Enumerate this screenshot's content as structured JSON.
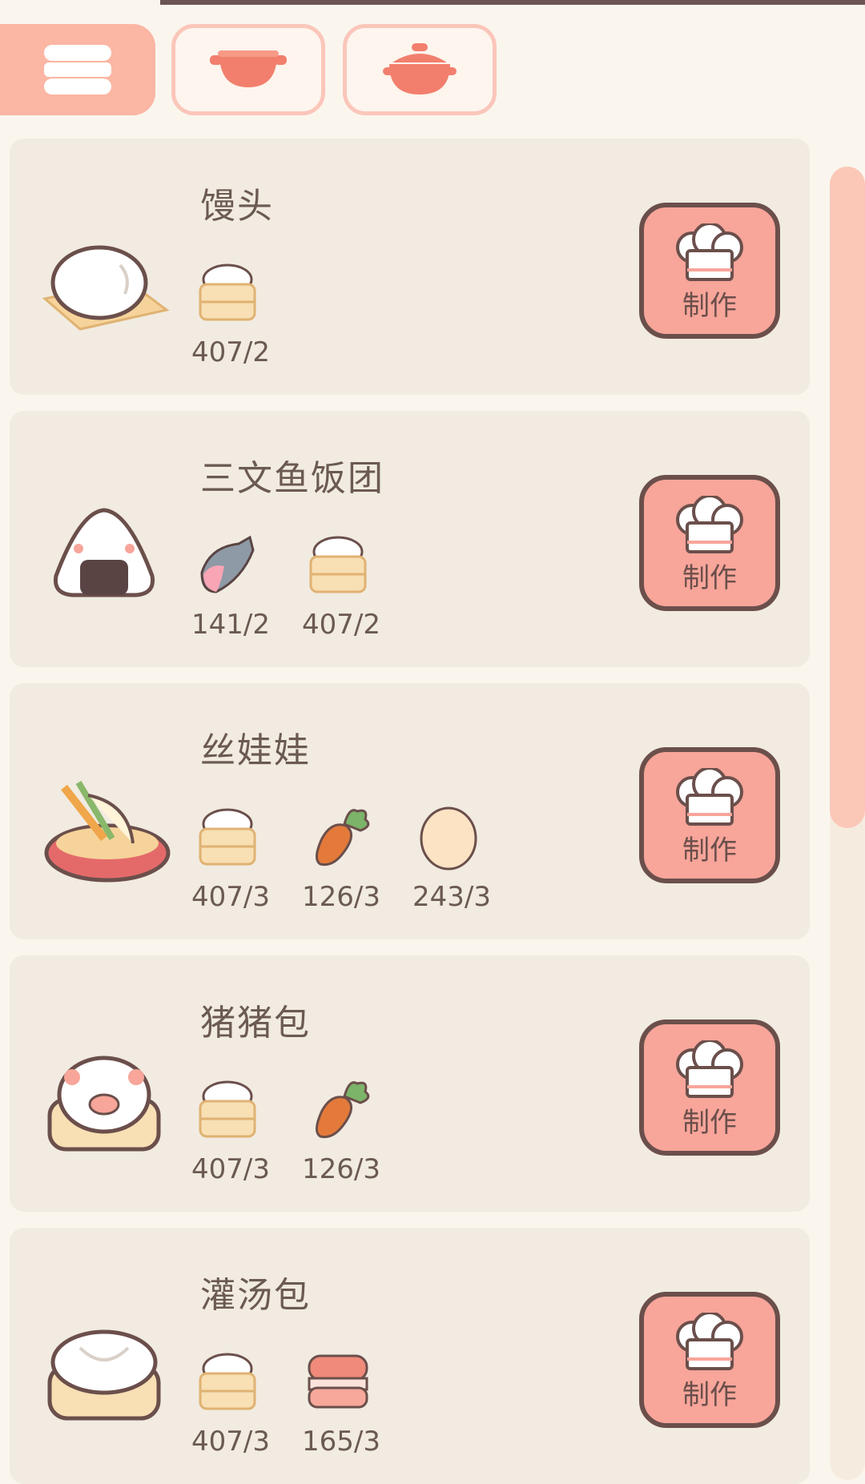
{
  "tabs": [
    {
      "icon": "steamer-icon",
      "active": true
    },
    {
      "icon": "pot-icon",
      "active": false
    },
    {
      "icon": "casserole-icon",
      "active": false
    }
  ],
  "make_label": "制作",
  "recipes": [
    {
      "name": "馒头",
      "image": "mantou-icon",
      "ingredients": [
        {
          "icon": "steamed-flour-icon",
          "count": "407/2"
        }
      ]
    },
    {
      "name": "三文鱼饭团",
      "image": "onigiri-icon",
      "ingredients": [
        {
          "icon": "salmon-icon",
          "count": "141/2"
        },
        {
          "icon": "steamed-flour-icon",
          "count": "407/2"
        }
      ]
    },
    {
      "name": "丝娃娃",
      "image": "siwawa-icon",
      "ingredients": [
        {
          "icon": "steamed-flour-icon",
          "count": "407/3"
        },
        {
          "icon": "carrot-icon",
          "count": "126/3"
        },
        {
          "icon": "egg-icon",
          "count": "243/3"
        }
      ]
    },
    {
      "name": "猪猪包",
      "image": "piggy-bun-icon",
      "ingredients": [
        {
          "icon": "steamed-flour-icon",
          "count": "407/3"
        },
        {
          "icon": "carrot-icon",
          "count": "126/3"
        }
      ]
    },
    {
      "name": "灌汤包",
      "image": "soup-dumpling-icon",
      "ingredients": [
        {
          "icon": "steamed-flour-icon",
          "count": "407/3"
        },
        {
          "icon": "meat-icon",
          "count": "165/3"
        }
      ]
    }
  ],
  "colors": {
    "accent": "#f8a59a",
    "card_bg": "#f1ebe1",
    "page_bg": "#faf6ee",
    "text": "#6b5a52",
    "scroll_thumb": "#fbc8b8"
  }
}
